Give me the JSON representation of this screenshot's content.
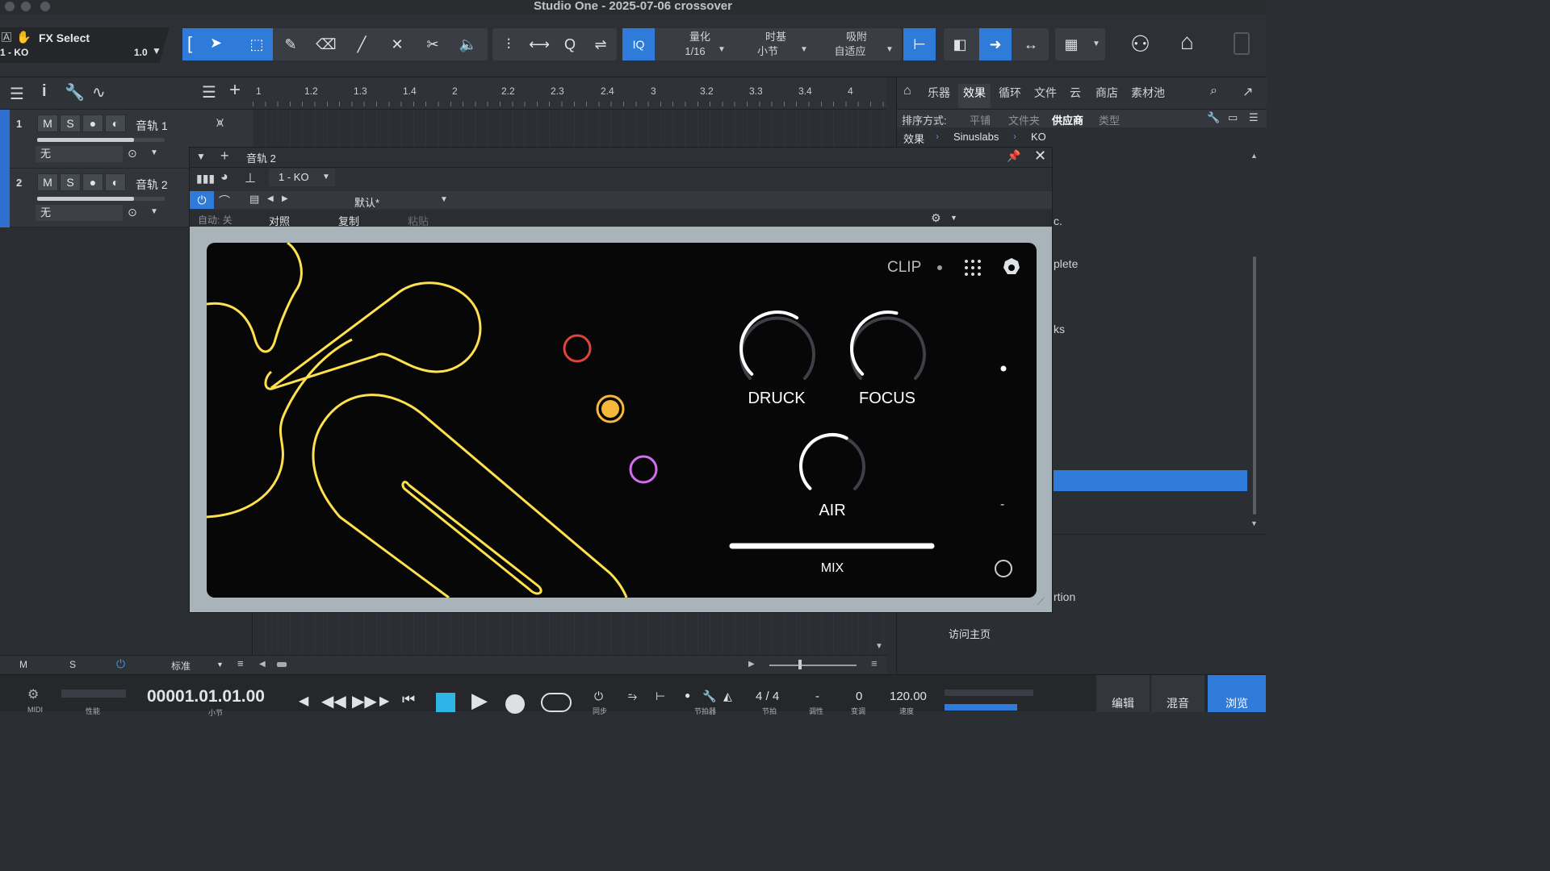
{
  "window": {
    "title": "Studio One - 2025-07-06 crossover"
  },
  "toolbar": {
    "fx_select_label": "FX Select",
    "fx_select_sub": "1 - KO",
    "fx_value": "1.0",
    "iq_label": "IQ",
    "quantize": {
      "label": "量化",
      "value": "1/16"
    },
    "timebase": {
      "label": "时基",
      "value": "小节"
    },
    "snap": {
      "label": "吸附",
      "value": "自适应"
    }
  },
  "ruler": {
    "ticks": [
      "1",
      "1.2",
      "1.3",
      "1.4",
      "2",
      "2.2",
      "2.3",
      "2.4",
      "3",
      "3.2",
      "3.3",
      "3.4",
      "4"
    ]
  },
  "tracks": [
    {
      "num": "1",
      "mute": "M",
      "solo": "S",
      "name": "音轨 1",
      "input": "无"
    },
    {
      "num": "2",
      "mute": "M",
      "solo": "S",
      "name": "音轨 2",
      "input": "无"
    }
  ],
  "plugin_window": {
    "track_name": "音轨 2",
    "insert_name": "1 - KO",
    "preset": "默认*",
    "auto": "自动: 关",
    "compare": "对照",
    "copy": "复制",
    "paste": "粘贴"
  },
  "plugin": {
    "clip_label": "CLIP",
    "knobs": [
      {
        "label": "DRUCK",
        "value": 0.62
      },
      {
        "label": "FOCUS",
        "value": 0.55
      },
      {
        "label": "AIR",
        "value": 0.6
      }
    ],
    "mix_label": "MIX",
    "mix_value": 1.0,
    "minus_label": "-",
    "accent_yellow": "#ffe14d",
    "dot_red": "#e0443c",
    "dot_orange": "#f6b73c",
    "dot_violet": "#d46cf0"
  },
  "browser": {
    "tabs": [
      "乐器",
      "效果",
      "循环",
      "文件",
      "云",
      "商店",
      "素材池"
    ],
    "active_tab": "效果",
    "sort_label": "排序方式:",
    "sort_options": [
      "平铺",
      "文件夹",
      "供应商",
      "类型"
    ],
    "active_sort": "供应商",
    "breadcrumb": [
      "效果",
      "Sinuslabs",
      "KO"
    ],
    "partial_items": [
      "c.",
      "plete",
      "ks",
      "rtion"
    ],
    "homepage_link": "访问主页"
  },
  "footer_left": {
    "m": "M",
    "s": "S",
    "mode": "标准"
  },
  "transport": {
    "midi_label": "MIDI",
    "perf_label": "性能",
    "time": "00001.01.01.00",
    "time_unit": "小节",
    "time_sig": "4 / 4",
    "time_sig_label": "节拍",
    "key": "-",
    "key_label": "调性",
    "transpose": "0",
    "transpose_label": "变调",
    "tempo": "120.00",
    "tempo_label": "速度",
    "sync_label": "同步",
    "metronome_label": "节拍器",
    "tabs": [
      "编辑",
      "混音",
      "浏览"
    ],
    "active_tab": "浏览"
  },
  "colors": {
    "accent_blue": "#2e7bd9",
    "track_stripe": "#2f6fcf"
  }
}
